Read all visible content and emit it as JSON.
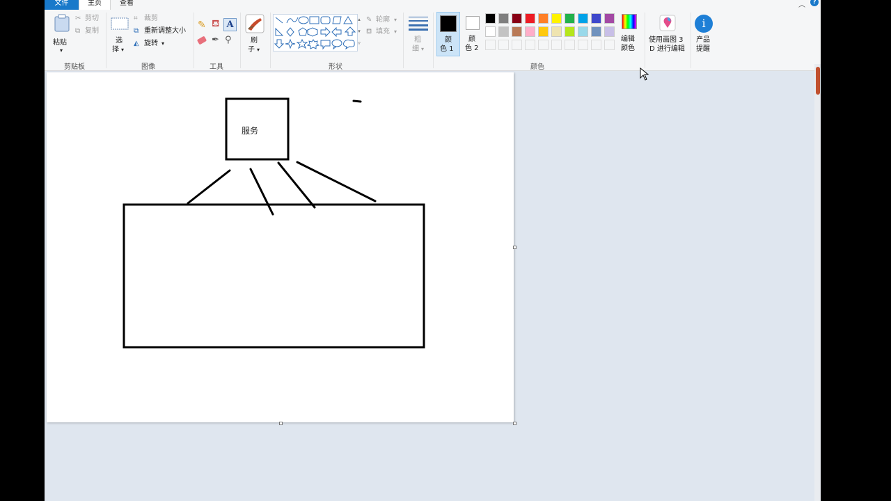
{
  "tabs": {
    "file": "文件",
    "home": "主页",
    "view": "查看"
  },
  "clipboard": {
    "paste": "粘贴",
    "cut": "剪切",
    "copy": "复制",
    "label": "剪贴板"
  },
  "image": {
    "select_line1": "选",
    "select_line2": "择",
    "crop": "裁剪",
    "resize": "重新调整大小",
    "rotate": "旋转",
    "label": "图像"
  },
  "tools": {
    "label": "工具"
  },
  "brushes": {
    "line1": "刷",
    "line2": "子"
  },
  "shapes": {
    "outline": "轮廓",
    "fill": "填充",
    "label": "形状"
  },
  "size": {
    "line1": "粗",
    "line2": "细"
  },
  "colors": {
    "color1_line1": "颜",
    "color1_line2": "色 1",
    "color2_line1": "颜",
    "color2_line2": "色 2",
    "edit_line1": "编辑",
    "edit_line2": "颜色",
    "label": "颜色",
    "color1": "#000000",
    "color2": "#ffffff",
    "palette_row1": [
      "#000000",
      "#7f7f7f",
      "#880015",
      "#ed1c24",
      "#ff7f27",
      "#fff200",
      "#22b14c",
      "#00a2e8",
      "#3f48cc",
      "#a349a4"
    ],
    "palette_row2": [
      "#ffffff",
      "#c3c3c3",
      "#b97a57",
      "#ffaec9",
      "#ffc90e",
      "#efe4b0",
      "#b5e61d",
      "#99d9ea",
      "#7092be",
      "#c8bfe7"
    ]
  },
  "paint3d": {
    "line1": "使用画图 3",
    "line2": "D 进行编辑"
  },
  "product": {
    "line1": "产品",
    "line2": "提醒"
  },
  "drawing": {
    "box_text": "服务"
  }
}
